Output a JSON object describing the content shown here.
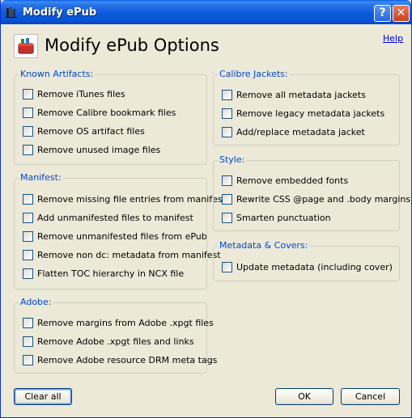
{
  "window": {
    "title": "Modify ePub",
    "help_button": "?",
    "close_button": "✕"
  },
  "header": {
    "title": "Modify ePub Options",
    "help_link": "Help"
  },
  "groups": {
    "known_artifacts": {
      "title": "Known Artifacts:",
      "items": [
        "Remove iTunes files",
        "Remove Calibre bookmark files",
        "Remove OS artifact files",
        "Remove unused image files"
      ]
    },
    "manifest": {
      "title": "Manifest:",
      "items": [
        "Remove missing file entries from manifest",
        "Add unmanifested files to manifest",
        "Remove unmanifested files from ePub",
        "Remove non dc: metadata from manifest",
        "Flatten TOC hierarchy in NCX file"
      ]
    },
    "adobe": {
      "title": "Adobe:",
      "items": [
        "Remove margins from Adobe .xpgt files",
        "Remove Adobe .xpgt files and links",
        "Remove Adobe resource DRM meta tags"
      ]
    },
    "calibre_jackets": {
      "title": "Calibre Jackets:",
      "items": [
        "Remove all metadata jackets",
        "Remove legacy metadata jackets",
        "Add/replace metadata jacket"
      ]
    },
    "style": {
      "title": "Style:",
      "items": [
        "Remove embedded fonts",
        "Rewrite CSS @page and .body margins",
        "Smarten punctuation"
      ]
    },
    "metadata_covers": {
      "title": "Metadata & Covers:",
      "items": [
        "Update metadata (including cover)"
      ]
    }
  },
  "buttons": {
    "clear_all": "Clear all",
    "ok": "OK",
    "cancel": "Cancel"
  },
  "colors": {
    "titlebar": "#0a55d6",
    "group_title": "#0046d5",
    "background": "#ece9d8"
  }
}
